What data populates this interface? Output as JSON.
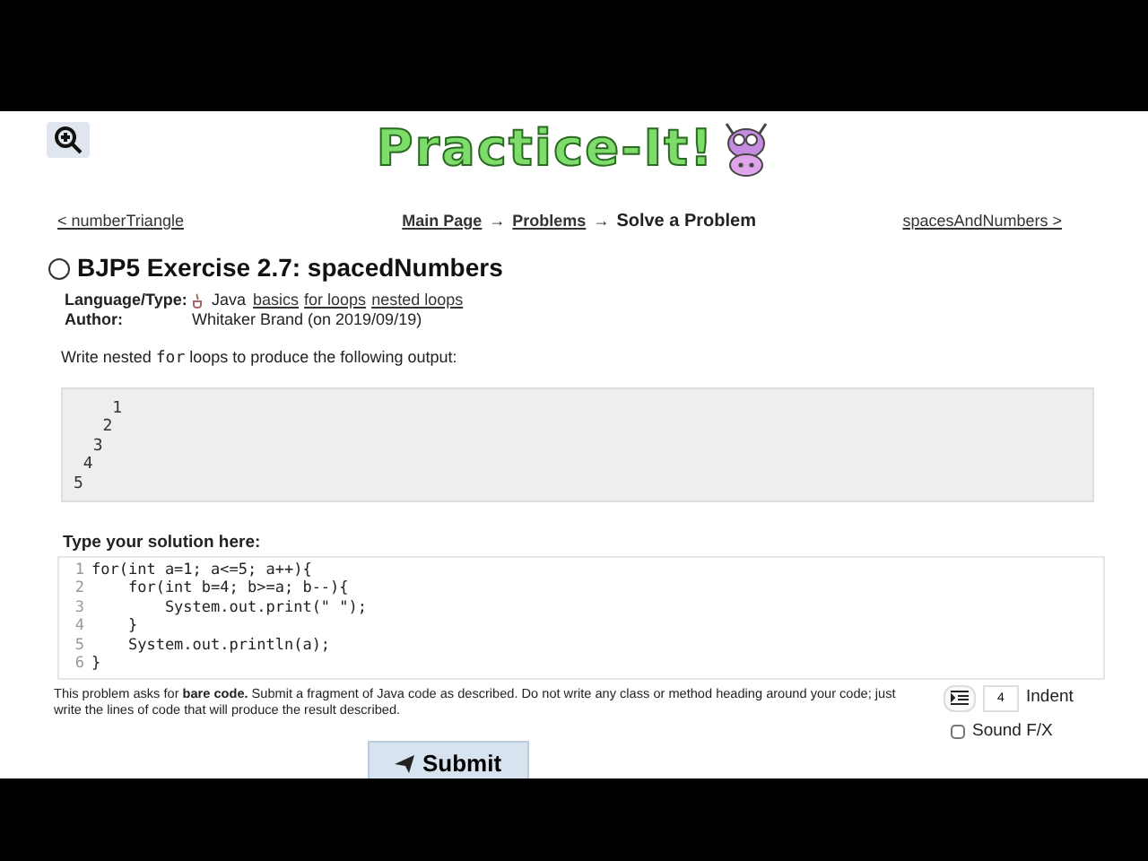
{
  "logo": {
    "text": "Practice-It!"
  },
  "nav": {
    "prev": "< numberTriangle",
    "breadcrumb": [
      "Main Page",
      "Problems"
    ],
    "separator": "→",
    "current": "Solve a Problem",
    "next": "spacesAndNumbers >"
  },
  "problem": {
    "solved": false,
    "title": "BJP5 Exercise 2.7: spacedNumbers",
    "language_label": "Language/Type:",
    "language": "Java",
    "tags": [
      "basics",
      "for loops",
      "nested loops"
    ],
    "author_label": "Author:",
    "author": "Whitaker Brand (on 2019/09/19)",
    "description": "Write nested **for** loops to produce the following output:",
    "output": [
      "    1",
      "   2",
      "  3",
      " 4",
      "5"
    ]
  },
  "editor": {
    "label": "Type your solution here:",
    "lines": [
      {
        "number": "1",
        "text": "for(int a=1; a<=5; a++){"
      },
      {
        "number": "2",
        "text": "    for(int b=4; b>=a; b--){"
      },
      {
        "number": "3",
        "text": "        System.out.print(\" \");"
      },
      {
        "number": "4",
        "text": "    }"
      },
      {
        "number": "5",
        "text": "    System.out.println(a);"
      },
      {
        "number": "6",
        "text": "}"
      }
    ]
  },
  "note": "This problem asks for **bare code.** Submit a fragment of Java code as described. Do not write any class or method heading around your code; just write the lines of code that will produce the result described.",
  "indent": {
    "value": "4",
    "label": "Indent"
  },
  "sound": {
    "label": "Sound F/X",
    "checked": false
  },
  "submit": "Submit"
}
